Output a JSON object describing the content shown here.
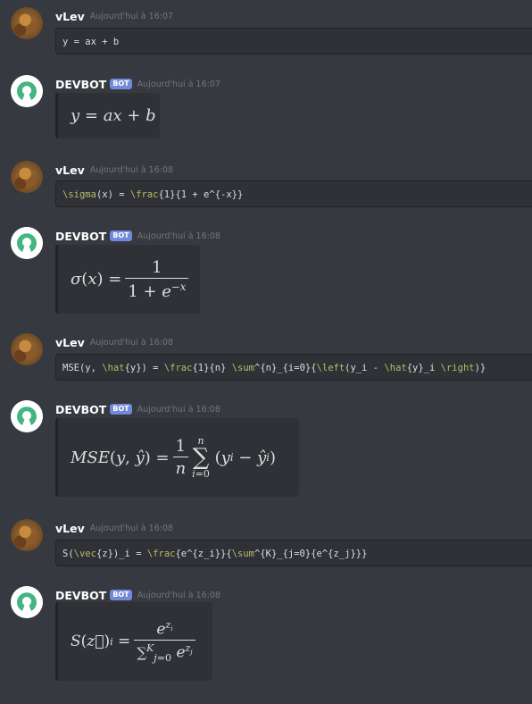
{
  "messages": [
    {
      "author": "vLev",
      "time": "Aujourd'hui à 16:07",
      "code": "y = ax + b"
    },
    {
      "author": "DEVBOT",
      "badge": "BOT",
      "time": "Aujourd'hui à 16:07"
    },
    {
      "author": "vLev",
      "time": "Aujourd'hui à 16:08",
      "code": "\\sigma(x) = \\frac{1}{1 + e^{-x}}"
    },
    {
      "author": "DEVBOT",
      "badge": "BOT",
      "time": "Aujourd'hui à 16:08"
    },
    {
      "author": "vLev",
      "time": "Aujourd'hui à 16:08",
      "code": "MSE(y, \\hat{y}) = \\frac{1}{n} \\sum^{n}_{i=0}{\\left(y_i - \\hat{y}_i \\right)}"
    },
    {
      "author": "DEVBOT",
      "badge": "BOT",
      "time": "Aujourd'hui à 16:08"
    },
    {
      "author": "vLev",
      "time": "Aujourd'hui à 16:08",
      "code": "S(\\vec{z})_i = \\frac{e^{z_i}}{\\sum^{K}_{j=0}{e^{z_j}}}"
    },
    {
      "author": "DEVBOT",
      "badge": "BOT",
      "time": "Aujourd'hui à 16:08"
    }
  ],
  "colors": {
    "background": "#36393f",
    "codeblock": "#2f3136",
    "badge": "#7289da",
    "bot_icon": "#43b581",
    "timestamp": "#72767d"
  },
  "icons": {
    "user_avatar": "avatar-image",
    "bot_avatar": "open-source-logo-icon"
  }
}
